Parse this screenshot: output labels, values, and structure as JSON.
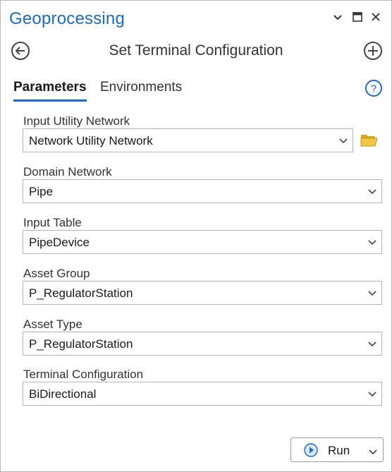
{
  "pane": {
    "title": "Geoprocessing",
    "accent_color": "#1b6ac9",
    "controls": [
      {
        "name": "chevron-down-icon",
        "label": "Options"
      },
      {
        "name": "maximize-icon",
        "label": "Maximize"
      },
      {
        "name": "close-icon",
        "label": "Close"
      }
    ]
  },
  "toolbar": {
    "back_icon": "back-arrow-icon",
    "tool_title": "Set Terminal Configuration",
    "add_icon": "plus-circle-icon"
  },
  "tabs": {
    "parameters": "Parameters",
    "environments": "Environments",
    "active": "parameters",
    "help_icon": "help-icon"
  },
  "parameters": [
    {
      "label": "Input Utility Network",
      "value": "Network Utility Network",
      "has_browse": true
    },
    {
      "label": "Domain Network",
      "value": "Pipe"
    },
    {
      "label": "Input Table",
      "value": "PipeDevice"
    },
    {
      "label": "Asset Group",
      "value": "P_RegulatorStation"
    },
    {
      "label": "Asset Type",
      "value": "P_RegulatorStation"
    },
    {
      "label": "Terminal Configuration",
      "value": "BiDirectional"
    }
  ],
  "run_button": {
    "label": "Run",
    "icon": "play-icon"
  }
}
